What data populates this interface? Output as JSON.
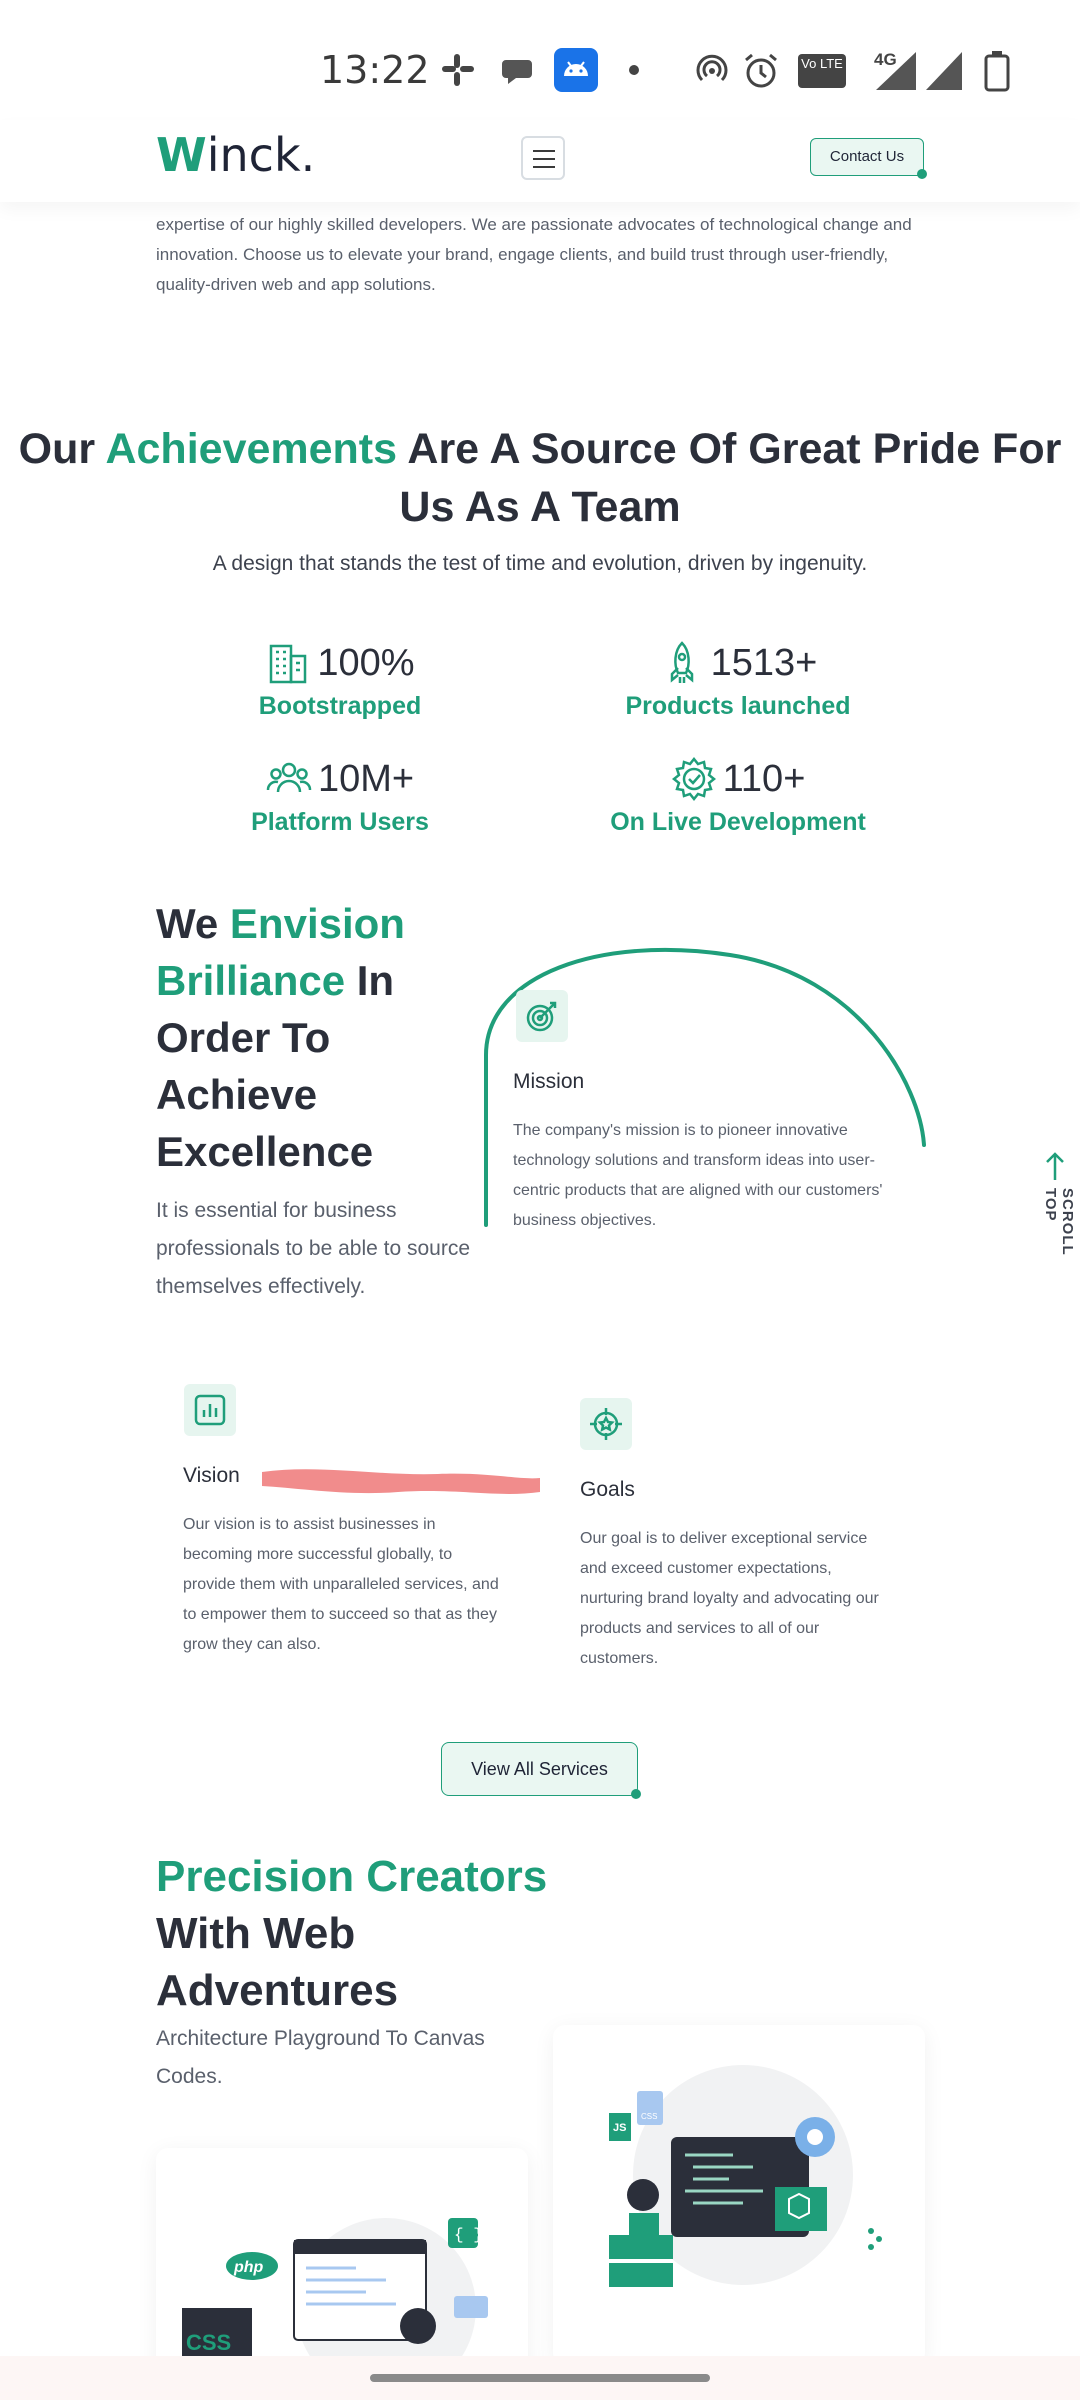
{
  "status_bar": {
    "time": "13:22",
    "network": "4G",
    "volte_label": "Vo LTE"
  },
  "header": {
    "logo_initial": "W",
    "logo_rest": "inck.",
    "contact_label": "Contact Us"
  },
  "intro_text": "expertise of our highly skilled developers. We are passionate advocates of technological change and innovation. Choose us to elevate your brand, engage clients, and build trust through user-friendly, quality-driven web and app solutions.",
  "achievements": {
    "title_pre": "Our ",
    "title_highlight": "Achievements",
    "title_post": " Are A Source Of Great Pride For Us As A Team",
    "subtitle": "A design that stands the test of time and evolution, driven by ingenuity.",
    "stats": [
      {
        "value": "100%",
        "label": "Bootstrapped",
        "icon": "building-icon"
      },
      {
        "value": "1513+",
        "label": "Products launched",
        "icon": "rocket-icon"
      },
      {
        "value": "10M+",
        "label": "Platform Users",
        "icon": "users-icon"
      },
      {
        "value": "110+",
        "label": "On Live Development",
        "icon": "gear-check-icon"
      }
    ]
  },
  "envision": {
    "title_pre": "We ",
    "title_highlight": "Envision Brilliance",
    "title_post": " In Order To Achieve Excellence",
    "subtitle": "It is essential for business professionals to be able to source themselves effectively."
  },
  "mission": {
    "title": "Mission",
    "text": "The company's mission is to pioneer innovative technology solutions and transform ideas into user-centric products that are aligned with our customers' business objectives."
  },
  "vision": {
    "title": "Vision",
    "text": "Our vision is to assist businesses in becoming more successful globally, to provide them with unparalleled services, and to empower them to succeed so that as they grow they can also."
  },
  "goals": {
    "title": "Goals",
    "text": "Our goal is to deliver exceptional service and exceed customer expectations, nurturing brand loyalty and advocating our products and services to all of our customers."
  },
  "services_button": "View All Services",
  "precision": {
    "title_highlight": "Precision Creators",
    "title_post": " With Web Adventures",
    "subtitle": "Architecture Playground To Canvas Codes."
  },
  "illustration_labels": {
    "php": "php",
    "css": "CSS",
    "js": "JS",
    "css_file": "CSS"
  },
  "scroll_top_label": "SCROLL TOP",
  "colors": {
    "accent": "#1f9e7a",
    "heading": "#2b2f3a",
    "body": "#5a606c"
  }
}
